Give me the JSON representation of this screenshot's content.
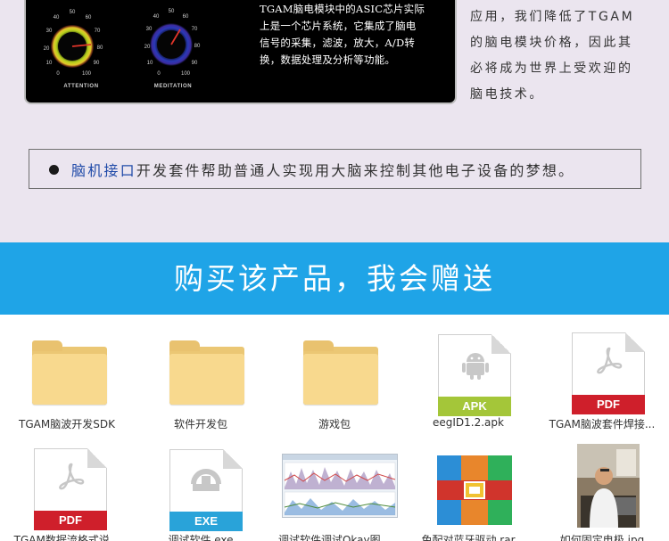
{
  "tgam_panel": {
    "gauges": [
      {
        "label": "ATTENTION",
        "ticks": [
          "0",
          "10",
          "20",
          "30",
          "40",
          "50",
          "60",
          "70",
          "80",
          "90",
          "100"
        ],
        "ring_color": "#d6e82a"
      },
      {
        "label": "MEDITATION",
        "ticks": [
          "0",
          "10",
          "20",
          "30",
          "40",
          "50",
          "60",
          "70",
          "80",
          "90",
          "100"
        ],
        "ring_color": "#2a3ab8"
      }
    ],
    "description_lines": [
      "TGAM脑电模块中的ASIC芯片实际",
      "上是一个芯片系统，它集成了脑电",
      "信号的采集，滤波，放大，A/D转",
      "换，数据处理及分析等功能。"
    ]
  },
  "right_text_lines": [
    "应用，我们降低了TGAM",
    "的脑电模块价格，因此其",
    "必将成为世界上受欢迎的",
    "脑电技术。"
  ],
  "dream": {
    "highlight": "脑机接口",
    "rest": "开发套件帮助普通人实现用大脑来控制其他电子设备的梦想。"
  },
  "banner": {
    "title": "购买该产品，我会赠送"
  },
  "files": [
    {
      "kind": "folder",
      "label": "TGAM脑波开发SDK"
    },
    {
      "kind": "folder",
      "label": "软件开发包"
    },
    {
      "kind": "folder",
      "label": "游戏包"
    },
    {
      "kind": "apk",
      "label": "eegID1.2.apk",
      "badge": "APK",
      "badge_color": "#a4c639"
    },
    {
      "kind": "pdf",
      "label": "TGAM脑波套件焊接...",
      "badge": "PDF",
      "badge_color": "#cf1f2b"
    },
    {
      "kind": "pdf",
      "label": "TGAM数据流格式说...",
      "badge": "PDF",
      "badge_color": "#cf1f2b"
    },
    {
      "kind": "exe",
      "label": "调试软件.exe",
      "badge": "EXE",
      "badge_color": "#29a3d9"
    },
    {
      "kind": "image",
      "label": "调试软件调试Okay图..."
    },
    {
      "kind": "rar",
      "label": "免配对蓝牙驱动.rar"
    },
    {
      "kind": "photo",
      "label": "如何固定电极.jpg"
    }
  ],
  "colors": {
    "lavender": "#ebe5ef",
    "banner_blue": "#1fa4e7",
    "highlight_blue": "#1f4aa8"
  }
}
